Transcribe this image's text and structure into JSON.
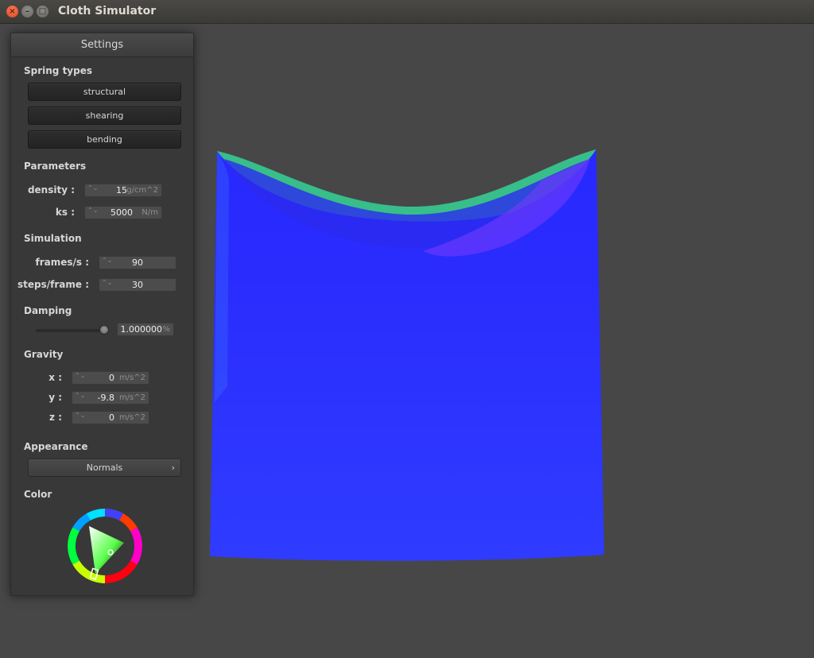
{
  "window": {
    "title": "Cloth Simulator",
    "buttons": [
      "×",
      "–",
      "□"
    ]
  },
  "settings": {
    "header": "Settings",
    "spring_types": {
      "label": "Spring types",
      "buttons": [
        "structural",
        "shearing",
        "bending"
      ]
    },
    "parameters": {
      "label": "Parameters",
      "density": {
        "label": "density :",
        "value": "15",
        "unit": "g/cm^2"
      },
      "ks": {
        "label": "ks :",
        "value": "5000",
        "unit": "N/m"
      }
    },
    "simulation": {
      "label": "Simulation",
      "frames": {
        "label": "frames/s :",
        "value": "90"
      },
      "steps": {
        "label": "steps/frame :",
        "value": "30"
      }
    },
    "damping": {
      "label": "Damping",
      "value": "1.000000",
      "unit": "%",
      "slider_fraction": 0.95
    },
    "gravity": {
      "label": "Gravity",
      "x": {
        "label": "x :",
        "value": "0",
        "unit": "m/s^2"
      },
      "y": {
        "label": "y :",
        "value": "-9.8",
        "unit": "m/s^2"
      },
      "z": {
        "label": "z :",
        "value": "0",
        "unit": "m/s^2"
      }
    },
    "appearance": {
      "label": "Appearance",
      "selected": "Normals",
      "chevron": "›"
    },
    "color": {
      "label": "Color",
      "selected_hex": "#5aff4a"
    }
  },
  "icons": {
    "spinner": "⌃⌄",
    "close": "close-icon",
    "minimize": "minimize-icon",
    "maximize": "maximize-icon"
  },
  "colors": {
    "background": "#474747",
    "cloth_base": "#2b2bff",
    "cloth_fold": "#3dff5a"
  }
}
